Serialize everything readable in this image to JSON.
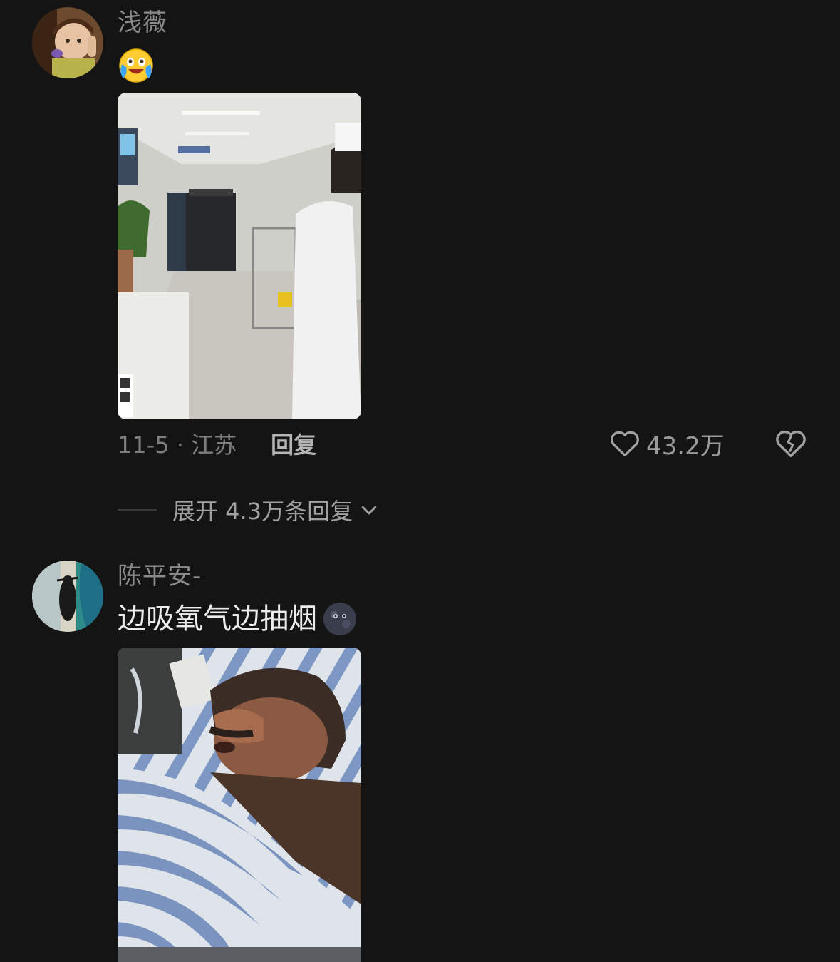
{
  "comments": [
    {
      "username": "浅薇",
      "text": "",
      "emoji": "crying-laughing-emoji",
      "image": "hospital-corridor-photo",
      "date_location": "11-5 · 江苏",
      "reply_label": "回复",
      "like_count": "43.2万",
      "expand_label": "展开 4.3万条回复"
    },
    {
      "username": "陈平安-",
      "text": "边吸氧气边抽烟",
      "emoji": "dark-moon-face-emoji",
      "image": "patient-in-bed-photo"
    }
  ],
  "colors": {
    "background": "#141414",
    "username": "#8a8a8a",
    "comment_text": "#ececec",
    "meta": "#8a8a8a"
  }
}
